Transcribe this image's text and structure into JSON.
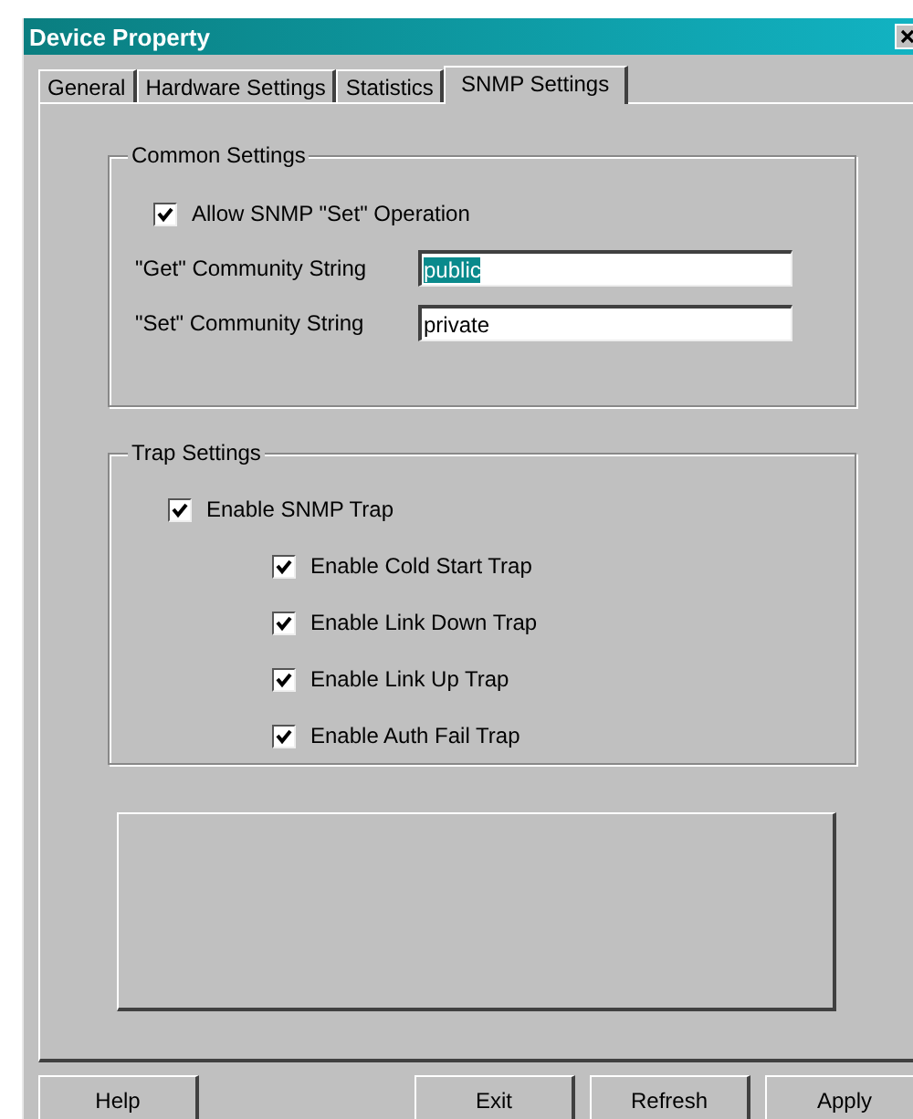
{
  "window": {
    "title": "Device Property"
  },
  "tabs": [
    {
      "label": "General",
      "selected": false
    },
    {
      "label": "Hardware Settings",
      "selected": false
    },
    {
      "label": "Statistics",
      "selected": false
    },
    {
      "label": "SNMP Settings",
      "selected": true
    }
  ],
  "common_settings": {
    "title": "Common Settings",
    "allow_set": {
      "label": "Allow SNMP \"Set\" Operation",
      "checked": true
    },
    "fields": [
      {
        "label": "\"Get\" Community String",
        "value": "public",
        "highlighted": true
      },
      {
        "label": "\"Set\" Community String",
        "value": "private",
        "highlighted": false
      }
    ]
  },
  "trap_settings": {
    "title": "Trap Settings",
    "enable": {
      "label": "Enable SNMP Trap",
      "checked": true
    },
    "traps": [
      {
        "label": "Enable Cold Start Trap",
        "checked": true
      },
      {
        "label": "Enable Link Down Trap",
        "checked": true
      },
      {
        "label": "Enable Link Up Trap",
        "checked": true
      },
      {
        "label": "Enable Auth Fail Trap",
        "checked": true
      }
    ]
  },
  "buttons": [
    {
      "label": "Help"
    },
    {
      "label": "Exit"
    },
    {
      "label": "Refresh"
    },
    {
      "label": "Apply"
    }
  ]
}
